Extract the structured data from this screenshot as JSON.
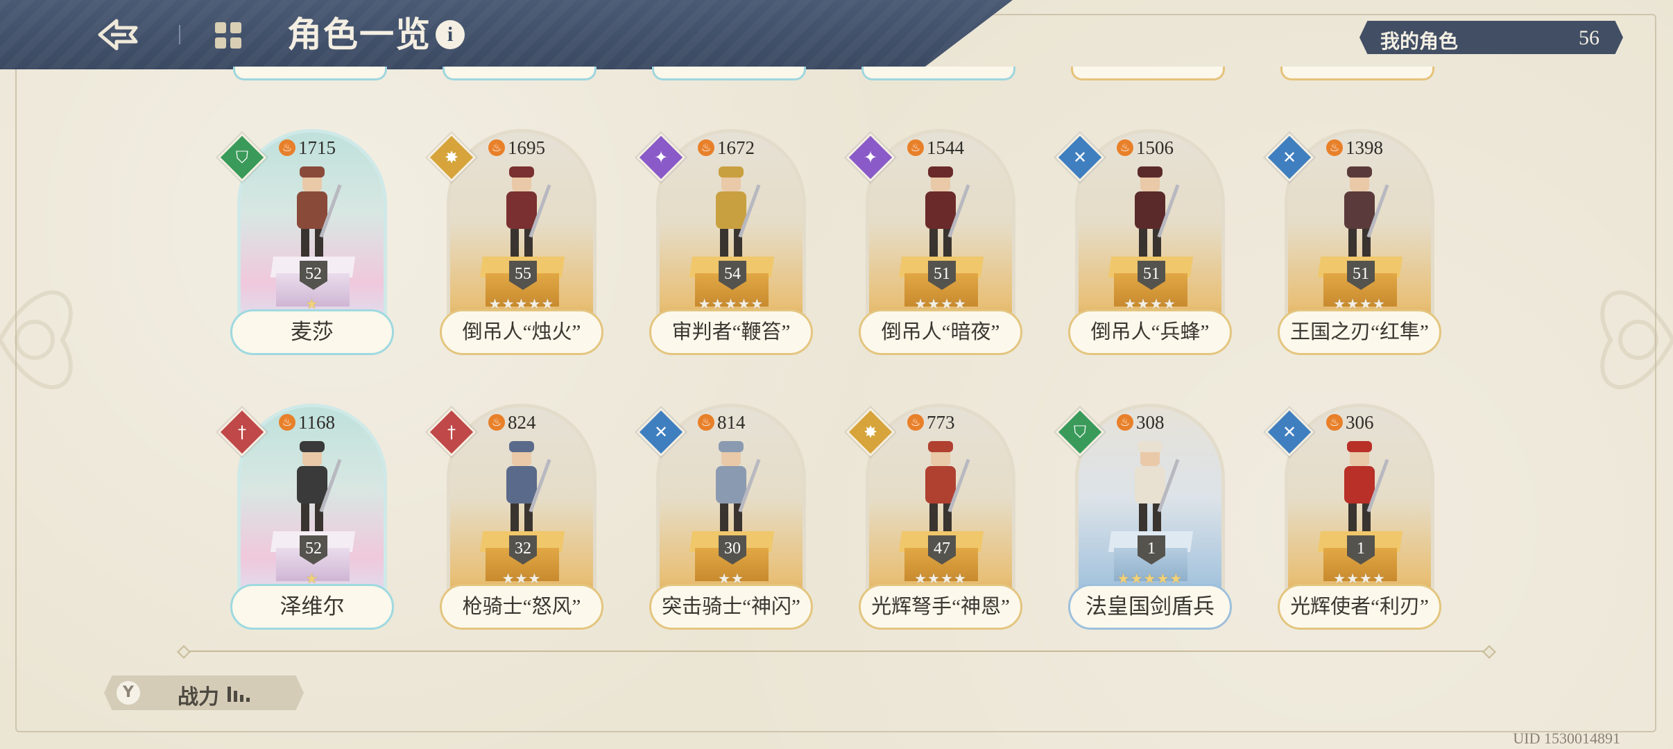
{
  "header": {
    "title": "角色一览",
    "info_symbol": "i",
    "my_characters_label": "我的角色",
    "my_characters_count": "56"
  },
  "colors": {
    "header_bg": "#3b4962",
    "gold_frame": "#e4c57f",
    "teal_frame": "#9fd9e0",
    "blue_frame": "#9ec0dc",
    "class_green": "#3a9a5a",
    "class_gold": "#d6a43a",
    "class_purple": "#8a5ac8",
    "class_blue": "#3f7fbf",
    "class_red": "#c04848"
  },
  "characters": [
    {
      "name": "麦莎",
      "power": "1715",
      "level": "52",
      "stars": 1,
      "max_stars": 1,
      "class_icon": "shield-icon",
      "rarity_style": "teal"
    },
    {
      "name": "倒吊人“烛火”",
      "power": "1695",
      "level": "55",
      "stars": 0,
      "max_stars": 5,
      "class_icon": "sun-icon",
      "rarity_style": "gold"
    },
    {
      "name": "审判者“鞭笞”",
      "power": "1672",
      "level": "54",
      "stars": 0,
      "max_stars": 5,
      "class_icon": "magic-icon",
      "rarity_style": "gold"
    },
    {
      "name": "倒吊人“暗夜”",
      "power": "1544",
      "level": "51",
      "stars": 0,
      "max_stars": 4,
      "class_icon": "magic-icon",
      "rarity_style": "gold"
    },
    {
      "name": "倒吊人“兵蜂”",
      "power": "1506",
      "level": "51",
      "stars": 0,
      "max_stars": 4,
      "class_icon": "crossed-swords-icon",
      "rarity_style": "gold"
    },
    {
      "name": "王国之刃“红隼”",
      "power": "1398",
      "level": "51",
      "stars": 0,
      "max_stars": 4,
      "class_icon": "crossed-swords-icon",
      "rarity_style": "gold"
    },
    {
      "name": "泽维尔",
      "power": "1168",
      "level": "52",
      "stars": 1,
      "max_stars": 1,
      "class_icon": "sword-icon",
      "rarity_style": "teal"
    },
    {
      "name": "枪骑士“怒风”",
      "power": "824",
      "level": "32",
      "stars": 0,
      "max_stars": 3,
      "class_icon": "sword-icon",
      "rarity_style": "gold"
    },
    {
      "name": "突击骑士“神闪”",
      "power": "814",
      "level": "30",
      "stars": 0,
      "max_stars": 2,
      "class_icon": "crossed-swords-icon",
      "rarity_style": "gold"
    },
    {
      "name": "光辉弩手“神恩”",
      "power": "773",
      "level": "47",
      "stars": 0,
      "max_stars": 4,
      "class_icon": "sun-icon",
      "rarity_style": "gold"
    },
    {
      "name": "法皇国剑盾兵",
      "power": "308",
      "level": "1",
      "stars": 5,
      "max_stars": 5,
      "class_icon": "shield-icon",
      "rarity_style": "blue"
    },
    {
      "name": "光辉使者“利刃”",
      "power": "306",
      "level": "1",
      "stars": 0,
      "max_stars": 4,
      "class_icon": "crossed-swords-icon",
      "rarity_style": "gold"
    }
  ],
  "footer": {
    "sort_label": "战力",
    "uid": "UID 1530014891"
  }
}
